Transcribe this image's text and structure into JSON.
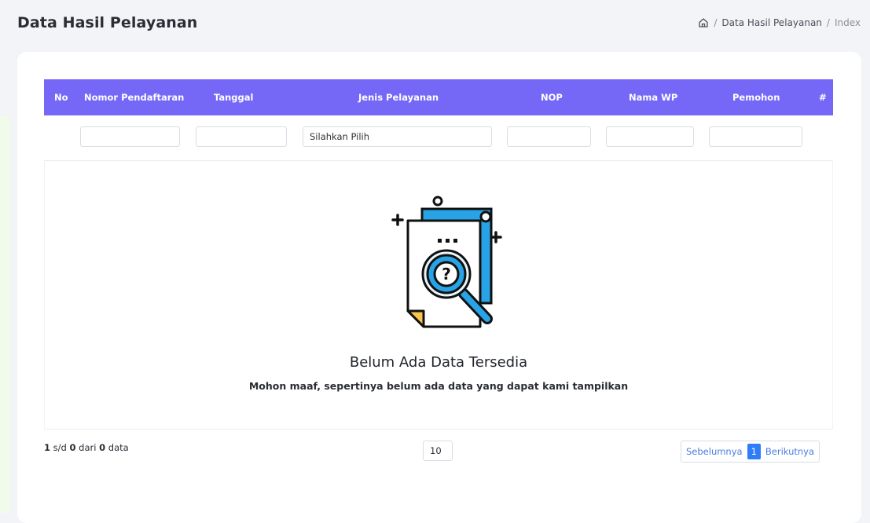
{
  "page": {
    "title": "Data Hasil Pelayanan",
    "breadcrumb": [
      "Data Hasil Pelayanan",
      "Index"
    ]
  },
  "table": {
    "columns": [
      "No",
      "Nomor Pendaftaran",
      "Tanggal",
      "Jenis Pelayanan",
      "NOP",
      "Nama WP",
      "Pemohon",
      "#"
    ],
    "filters": {
      "nomor_pendaftaran": "",
      "tanggal": "",
      "jenis_pelayanan": "Silahkan Pilih",
      "nop": "",
      "nama_wp": "",
      "pemohon": ""
    },
    "header_color": "#7568f7"
  },
  "empty_state": {
    "title": "Belum Ada Data Tersedia",
    "message": "Mohon maaf, sepertinya belum ada data yang dapat kami tampilkan",
    "icon": "document-search-icon"
  },
  "footer": {
    "range_start": "1",
    "sd": "s/d",
    "range_end": "0",
    "dari": "dari",
    "total": "0",
    "data": "data",
    "page_size": "10"
  },
  "pagination": {
    "prev": "Sebelumnya",
    "current": "1",
    "next": "Berikutnya"
  }
}
